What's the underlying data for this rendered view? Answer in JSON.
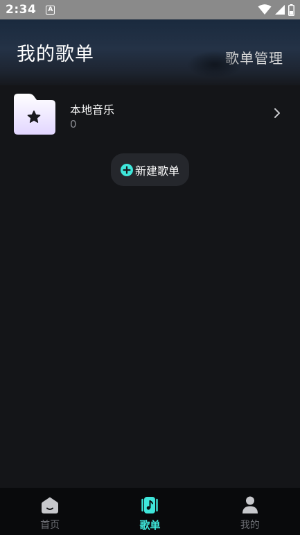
{
  "status_bar": {
    "time": "2:34",
    "notification_letter": "A"
  },
  "header": {
    "title": "我的歌单",
    "manage_label": "歌单管理"
  },
  "playlists": [
    {
      "name": "本地音乐",
      "count": "0",
      "icon": "star-folder-icon"
    }
  ],
  "new_playlist": {
    "label": "新建歌单",
    "icon": "plus-circle-icon"
  },
  "bottom_nav": {
    "items": [
      {
        "label": "首页",
        "icon": "home-icon",
        "active": false
      },
      {
        "label": "歌单",
        "icon": "music-playlist-icon",
        "active": true
      },
      {
        "label": "我的",
        "icon": "person-icon",
        "active": false
      }
    ]
  },
  "colors": {
    "accent": "#3fe6da",
    "background": "#141518",
    "nav_background": "#090a0c",
    "inactive": "#6f7177"
  }
}
